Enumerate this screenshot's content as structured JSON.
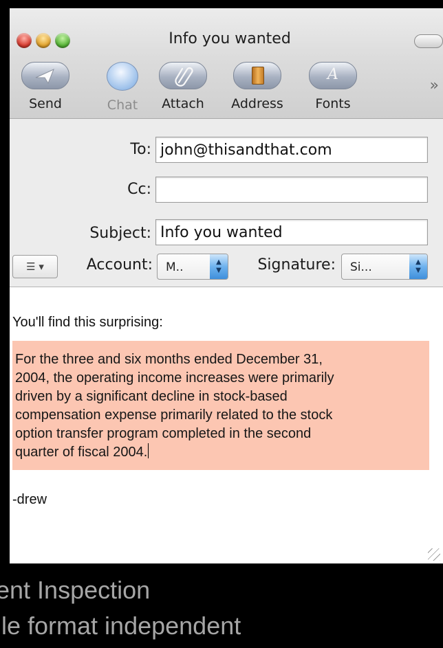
{
  "window": {
    "title": "Info you wanted"
  },
  "toolbar": {
    "buttons": [
      {
        "label": "Send",
        "icon": "send-icon"
      },
      {
        "label": "Chat",
        "icon": "chat-icon"
      },
      {
        "label": "Attach",
        "icon": "attach-icon"
      },
      {
        "label": "Address",
        "icon": "address-book-icon"
      },
      {
        "label": "Fonts",
        "icon": "fonts-icon"
      }
    ],
    "overflow": "»"
  },
  "header": {
    "to_label": "To:",
    "to_value": "john@thisandthat.com",
    "cc_label": "Cc:",
    "cc_value": "",
    "subject_label": "Subject:",
    "subject_value": "Info you wanted",
    "account_label": "Account:",
    "account_value": "M..",
    "signature_label": "Signature:",
    "signature_value": "Si..."
  },
  "message": {
    "intro": "You'll find this surprising:",
    "quote_lines": [
      "For the three and six months ended December 31,",
      "2004, the operating income increases were primarily",
      "driven by a significant decline in stock-based",
      "compensation expense primarily related to the stock",
      "option transfer program completed in the second",
      "quarter of fiscal 2004."
    ],
    "signoff": "-drew"
  },
  "background_text": {
    "line1": "ent Inspection",
    "line2": "ile format independent"
  },
  "colors": {
    "quote_highlight": "#fcc6b2",
    "background": "#000000"
  }
}
